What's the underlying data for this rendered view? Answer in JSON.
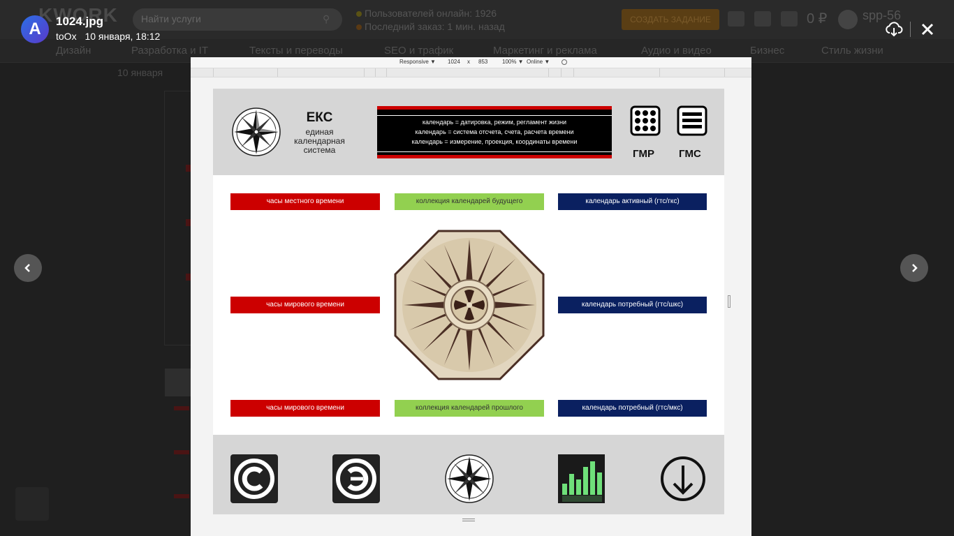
{
  "background_site": {
    "logo": "KWORK",
    "search_placeholder": "Найти услуги",
    "online_users": "Пользователей онлайн: 1926",
    "last_order": "Последний заказ: 1 мин. назад",
    "create_task": "СОЗДАТЬ ЗАДАНИЕ",
    "balance": "0 ₽",
    "username": "spp-56",
    "nav": [
      "Дизайн",
      "Разработка и IT",
      "Тексты и переводы",
      "SEO и трафик",
      "Маркетинг и реклама",
      "Аудио и видео",
      "Бизнес",
      "Стиль жизни"
    ],
    "date": "10 января"
  },
  "viewer": {
    "app_icon": "A",
    "file_name": "1024.jpg",
    "author": "toOx",
    "timestamp": "10 января, 18:12",
    "icons": [
      "download-icon",
      "close-icon",
      "chevron-left-icon",
      "chevron-right-icon"
    ]
  },
  "devtools": {
    "device": "Responsive ▼",
    "width": "1024",
    "x": "x",
    "height": "853",
    "zoom": "100% ▼",
    "network": "Online ▼"
  },
  "image": {
    "title": "ЕКС",
    "subtitle": "единая календарная система",
    "definitions": [
      "календарь = датировка, режим, регламент жизни",
      "календарь = система отсчета, счета, расчета времени",
      "календарь = измерение, проекция, координаты времени"
    ],
    "gmr": "ГМР",
    "gms": "ГМС",
    "tags": {
      "local_clock": "часы местного времени",
      "future": "коллекция календарей будущего",
      "active": "календарь активный (гтс/гкс)",
      "world_clock_1": "часы мирового времени",
      "consumer_shks": "календарь потребный (гтс/шкс)",
      "world_clock_2": "часы мирового времени",
      "past": "коллекция календарей прошлого",
      "consumer_mks": "календарь потребный (гтс/мкс)"
    },
    "colors": {
      "red": "#cc0000",
      "green": "#92d050",
      "navy": "#0a2060",
      "grey": "#d6d6d6"
    }
  }
}
